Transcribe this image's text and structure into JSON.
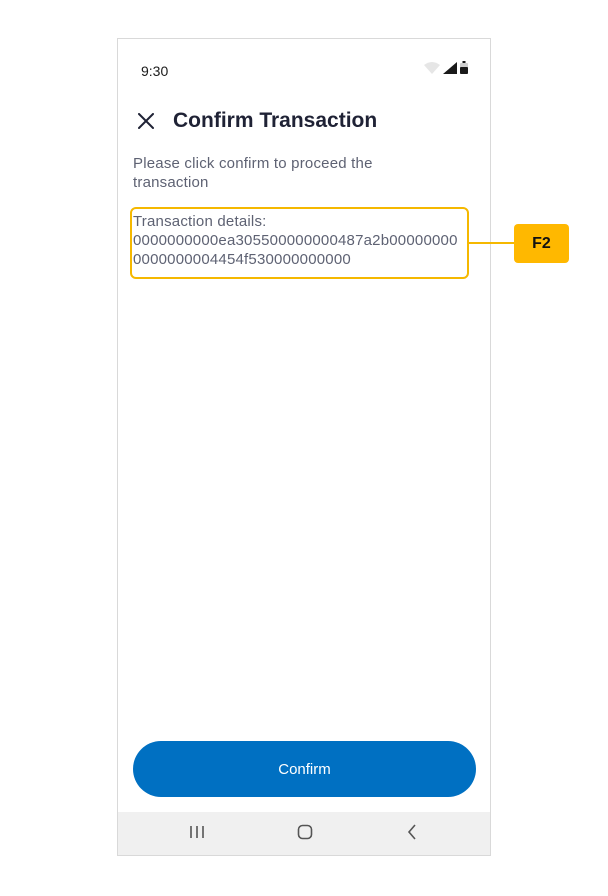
{
  "status_bar": {
    "time": "9:30",
    "icons": [
      "wifi-icon",
      "signal-icon",
      "battery-icon"
    ]
  },
  "header": {
    "close_icon": "close-icon",
    "title": "Confirm Transaction"
  },
  "main": {
    "description": "Please click confirm to proceed the transaction",
    "details_label": "Transaction details:",
    "details_value": "0000000000ea305500000000487a2b000000000000000004454f530000000000"
  },
  "actions": {
    "confirm_label": "Confirm"
  },
  "nav_bar": {
    "icons": [
      "recents-icon",
      "home-icon",
      "back-icon"
    ]
  },
  "annotation": {
    "tag": "F2"
  },
  "colors": {
    "primary": "#0070c2",
    "highlight": "#f5b800",
    "title": "#1f2235",
    "text": "#5e6273"
  }
}
